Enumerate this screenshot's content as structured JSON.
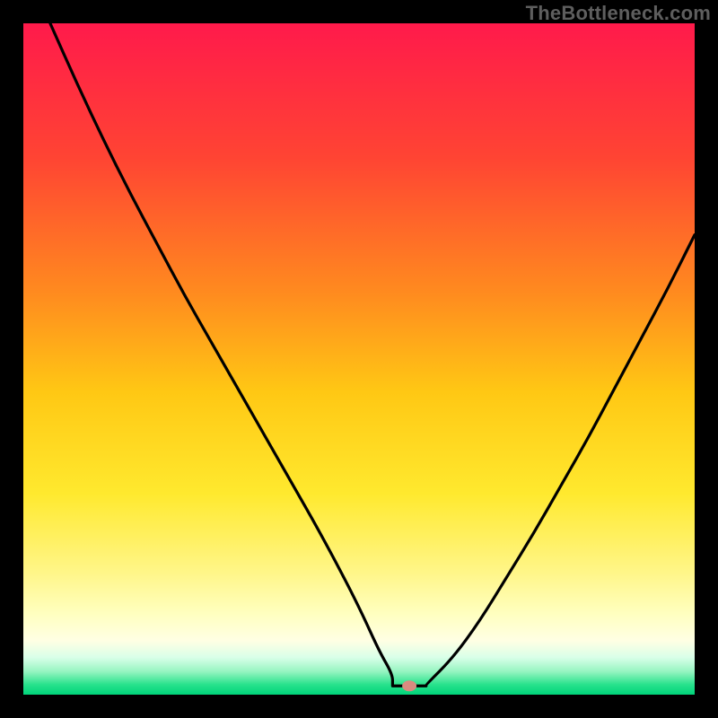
{
  "attribution": "TheBottleneck.com",
  "chart_data": {
    "type": "line",
    "title": "",
    "xlabel": "",
    "ylabel": "",
    "xlim": [
      0,
      100
    ],
    "ylim": [
      0,
      100
    ],
    "grid": false,
    "legend": false,
    "gradient_stops": [
      {
        "pos": 0.0,
        "color": "#ff1a4b"
      },
      {
        "pos": 0.2,
        "color": "#ff4433"
      },
      {
        "pos": 0.4,
        "color": "#ff8a1f"
      },
      {
        "pos": 0.55,
        "color": "#ffc814"
      },
      {
        "pos": 0.7,
        "color": "#ffe92e"
      },
      {
        "pos": 0.82,
        "color": "#fff68a"
      },
      {
        "pos": 0.88,
        "color": "#ffffc0"
      },
      {
        "pos": 0.92,
        "color": "#ffffe4"
      },
      {
        "pos": 0.945,
        "color": "#d8ffe8"
      },
      {
        "pos": 0.965,
        "color": "#98f5c2"
      },
      {
        "pos": 0.985,
        "color": "#28e28c"
      },
      {
        "pos": 1.0,
        "color": "#00d47a"
      }
    ],
    "series": [
      {
        "name": "bottleneck-curve",
        "x": [
          4,
          8,
          12,
          16,
          20,
          24,
          28,
          32,
          36,
          40,
          44,
          48,
          50.5,
          53,
          55,
          56,
          58,
          60,
          64,
          68,
          72,
          76,
          80,
          84,
          88,
          92,
          96,
          100
        ],
        "y": [
          100,
          91,
          82.5,
          74.5,
          67,
          59.5,
          52.5,
          45.5,
          38.5,
          31.5,
          24.5,
          17,
          12,
          6.5,
          3.0,
          1.5,
          1.3,
          1.5,
          5.5,
          11,
          17.5,
          24,
          31,
          38,
          45.5,
          53,
          60.5,
          68.5
        ]
      }
    ],
    "plateau": {
      "x0": 55,
      "x1": 60,
      "y": 1.3
    },
    "marker": {
      "x": 57.5,
      "y": 1.3,
      "color": "#d98b80",
      "rx": 8,
      "ry": 6
    }
  }
}
